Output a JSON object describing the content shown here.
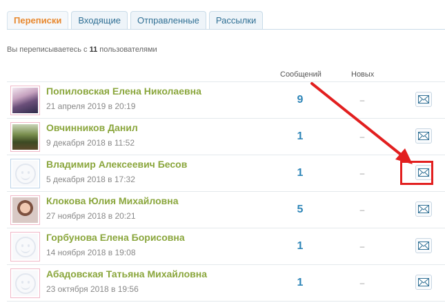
{
  "tabs": [
    {
      "label": "Переписки",
      "active": true
    },
    {
      "label": "Входящие",
      "active": false
    },
    {
      "label": "Отправленные",
      "active": false
    },
    {
      "label": "Рассылки",
      "active": false
    }
  ],
  "summary": {
    "prefix": "Вы переписываетесь с",
    "count": "11",
    "suffix": "пользователями"
  },
  "columns": {
    "messages": "Сообщений",
    "new": "Новых"
  },
  "conversations": [
    {
      "name": "Попиловская Елена Николаевна",
      "date": "21 апреля 2019 в 20:19",
      "messages": "9",
      "new": "–",
      "avatar": "photo"
    },
    {
      "name": "Овчинников Данил",
      "date": "9 декабря 2018 в 11:52",
      "messages": "1",
      "new": "–",
      "avatar": "photo"
    },
    {
      "name": "Владимир Алексеевич Бесов",
      "date": "5 декабря 2018 в 17:32",
      "messages": "1",
      "new": "–",
      "avatar": "placeholder"
    },
    {
      "name": "Клокова Юлия Михайловна",
      "date": "27 ноября 2018 в 20:21",
      "messages": "5",
      "new": "–",
      "avatar": "photo"
    },
    {
      "name": "Горбунова Елена Борисовна",
      "date": "14 ноября 2018 в 19:08",
      "messages": "1",
      "new": "–",
      "avatar": "placeholder"
    },
    {
      "name": "Абадовская Татьяна Михайловна",
      "date": "23 октября 2018 в 19:56",
      "messages": "1",
      "new": "–",
      "avatar": "placeholder"
    }
  ],
  "colors": {
    "accent_tab": "#e8882e",
    "name": "#8aa63c",
    "count": "#2f86b8",
    "annotation": "#e21f1f"
  },
  "icons": {
    "write": "envelope-icon"
  }
}
